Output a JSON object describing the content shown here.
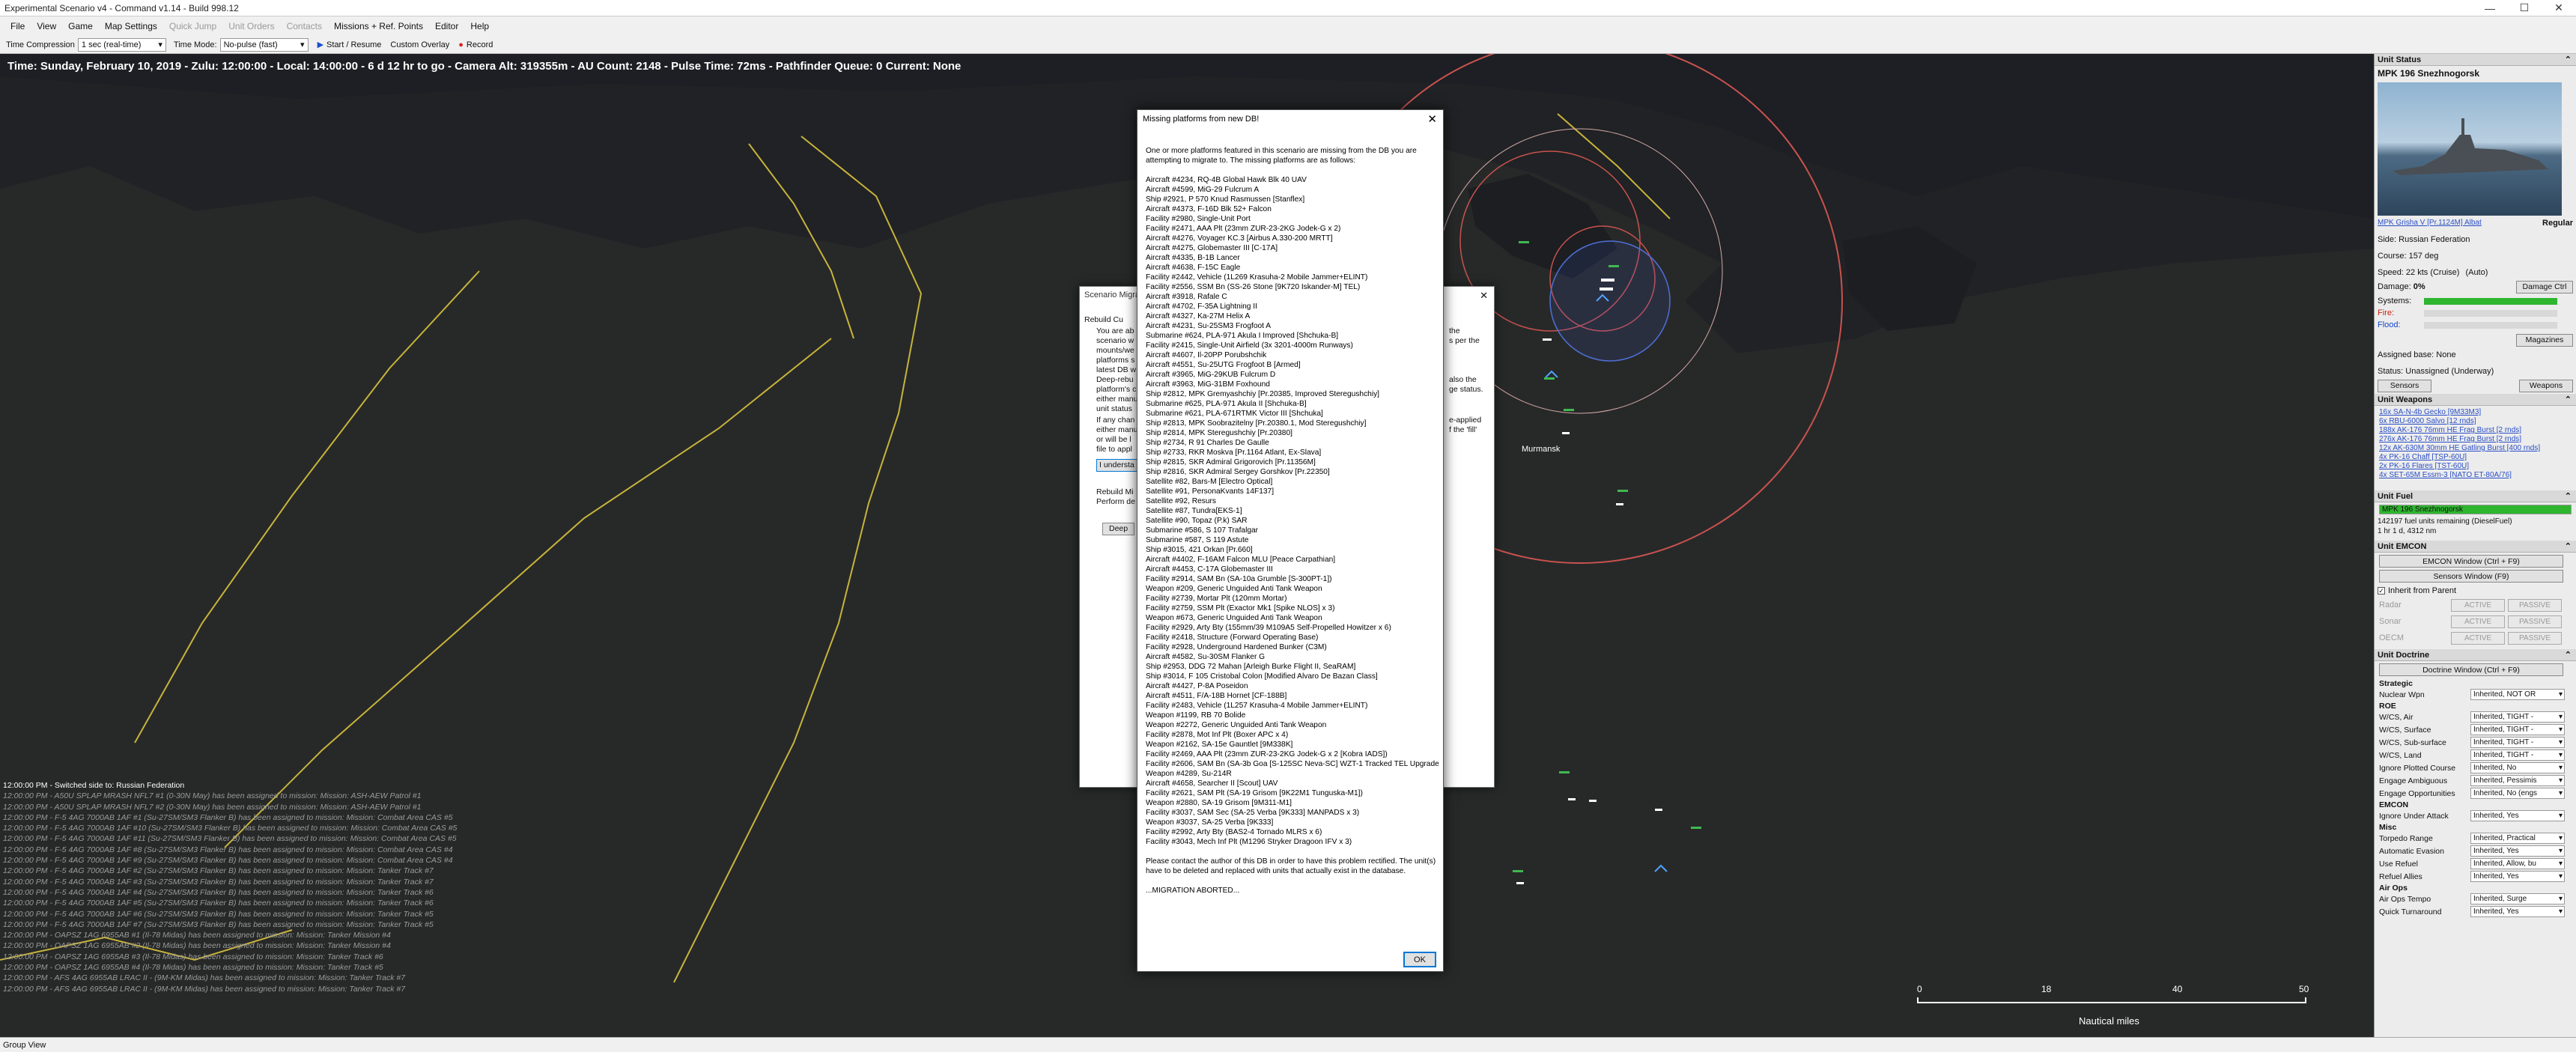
{
  "window": {
    "title": "Experimental Scenario v4 - Command v1.14 - Build 998.12",
    "controls": [
      "—",
      "☐",
      "✕"
    ]
  },
  "menu": [
    {
      "label": "File",
      "enabled": true
    },
    {
      "label": "View",
      "enabled": true
    },
    {
      "label": "Game",
      "enabled": true
    },
    {
      "label": "Map Settings",
      "enabled": true
    },
    {
      "label": "Quick Jump",
      "enabled": false
    },
    {
      "label": "Unit Orders",
      "enabled": false
    },
    {
      "label": "Contacts",
      "enabled": false
    },
    {
      "label": "Missions + Ref. Points",
      "enabled": true
    },
    {
      "label": "Editor",
      "enabled": true
    },
    {
      "label": "Help",
      "enabled": true
    }
  ],
  "toolbar": {
    "time_compression_label": "Time Compression",
    "time_compression_value": "1 sec (real-time)",
    "time_mode_label": "Time Mode:",
    "time_mode_value": "No-pulse (fast)",
    "start_resume": "Start / Resume",
    "custom_overlay": "Custom Overlay",
    "record": "Record"
  },
  "status_line": "Time: Sunday, February 10, 2019 - Zulu: 12:00:00 - Local: 14:00:00 - 6 d 12 hr to go -  Camera Alt: 319355m - AU Count: 2148 - Pulse Time: 72ms - Pathfinder Queue: 0 Current: None",
  "map": {
    "place_label": "Murmansk",
    "scale": {
      "ticks": [
        "0",
        "18",
        "40",
        "50"
      ],
      "unit": "Nautical miles"
    }
  },
  "message_log": [
    "12:00:00 PM - Switched side to: Russian Federation",
    "12:00:00 PM - A50U SPLAP MRASH NFL7 #1 (0-30N May) has been assigned to mission: Mission: ASH-AEW Patrol #1",
    "12:00:00 PM - A50U SPLAP MRASH NFL7 #2 (0-30N May) has been assigned to mission: Mission: ASH-AEW Patrol #1",
    "12:00:00 PM - F-5 4AG 7000AB 1AF #1 (Su-27SM/SM3 Flanker B) has been assigned to mission: Mission: Combat Area CAS #5",
    "12:00:00 PM - F-5 4AG 7000AB 1AF #10 (Su-27SM/SM3 Flanker B) has been assigned to mission: Mission: Combat Area CAS #5",
    "12:00:00 PM - F-5 4AG 7000AB 1AF #11 (Su-27SM/SM3 Flanker B) has been assigned to mission: Mission: Combat Area CAS #5",
    "12:00:00 PM - F-5 4AG 7000AB 1AF #8 (Su-27SM/SM3 Flanker B) has been assigned to mission: Mission: Combat Area CAS #4",
    "12:00:00 PM - F-5 4AG 7000AB 1AF #9 (Su-27SM/SM3 Flanker B) has been assigned to mission: Mission: Combat Area CAS #4",
    "12:00:00 PM - F-5 4AG 7000AB 1AF #2 (Su-27SM/SM3 Flanker B) has been assigned to mission: Mission: Tanker Track #7",
    "12:00:00 PM - F-5 4AG 7000AB 1AF #3 (Su-27SM/SM3 Flanker B) has been assigned to mission: Mission: Tanker Track #7",
    "12:00:00 PM - F-5 4AG 7000AB 1AF #4 (Su-27SM/SM3 Flanker B) has been assigned to mission: Mission: Tanker Track #6",
    "12:00:00 PM - F-5 4AG 7000AB 1AF #5 (Su-27SM/SM3 Flanker B) has been assigned to mission: Mission: Tanker Track #6",
    "12:00:00 PM - F-5 4AG 7000AB 1AF #6 (Su-27SM/SM3 Flanker B) has been assigned to mission: Mission: Tanker Track #5",
    "12:00:00 PM - F-5 4AG 7000AB 1AF #7 (Su-27SM/SM3 Flanker B) has been assigned to mission: Mission: Tanker Track #5",
    "12:00:00 PM - OAPSZ 1AG 6955AB #1 (Il-78 Midas) has been assigned to mission: Mission: Tanker Mission #4",
    "12:00:00 PM - OAPSZ 1AG 6955AB #2 (Il-78 Midas) has been assigned to mission: Mission: Tanker Mission #4",
    "12:00:00 PM - OAPSZ 1AG 6955AB #3 (Il-78 Midas) has been assigned to mission: Mission: Tanker Track #6",
    "12:00:00 PM - OAPSZ 1AG 6955AB #4 (Il-78 Midas) has been assigned to mission: Mission: Tanker Track #5",
    "12:00:00 PM - AFS 4AG 6955AB LRAC II - (9M-KM Midas) has been assigned to mission: Mission: Tanker Track #7",
    "12:00:00 PM - AFS 4AG 6955AB LRAC II - (9M-KM Midas) has been assigned to mission: Mission: Tanker Track #7"
  ],
  "bottom_bar": "Group View",
  "bg_dialog": {
    "title": "Scenario Migration",
    "fragments": [
      "Rebuild Cu",
      "You are ab",
      "scenario w",
      "mounts/we",
      "platforms s",
      "latest DB w",
      "Deep-rebu",
      "platform's c",
      "either manu",
      "unit status",
      "If any chan",
      "either manu",
      "or will be l",
      "file to appl",
      "I understa",
      "Rebuild Mi",
      "Perform de",
      "Deep",
      "the",
      "s per the",
      "also the",
      "ge status.",
      "e-applied",
      "f the 'fill'"
    ]
  },
  "dialog": {
    "title": "Missing platforms from new DB!",
    "intro": "One or more platforms featured in this scenario are missing from the DB you are attempting to migrate to. The missing platforms are as follows:",
    "items": [
      "Aircraft #4234, RQ-4B Global Hawk Blk 40 UAV",
      "Aircraft #4599, MiG-29 Fulcrum A",
      "Ship #2921, P 570 Knud Rasmussen [Stanflex]",
      "Aircraft #4373, F-16D Blk 52+ Falcon",
      "Facility #2980, Single-Unit Port",
      "Facility #2471, AAA Plt (23mm ZUR-23-2KG Jodek-G x 2)",
      "Aircraft #4276, Voyager KC.3 [Airbus A.330-200 MRTT]",
      "Aircraft #4275, Globemaster III [C-17A]",
      "Aircraft #4335, B-1B Lancer",
      "Aircraft #4638, F-15C Eagle",
      "Facility #2442, Vehicle (1L269 Krasuha-2 Mobile Jammer+ELINT)",
      "Facility #2556, SSM Bn (SS-26 Stone [9K720 Iskander-M] TEL)",
      "Aircraft #3918, Rafale C",
      "Aircraft #4702, F-35A Lightning II",
      "Aircraft #4327, Ka-27M Helix A",
      "Aircraft #4231, Su-25SM3 Frogfoot A",
      "Submarine #624, PLA-971 Akula I Improved [Shchuka-B]",
      "Facility #2415, Single-Unit Airfield (3x 3201-4000m Runways)",
      "Aircraft #4607, Il-20PP Porubshchik",
      "Aircraft #4551, Su-25UTG Frogfoot B [Armed]",
      "Aircraft #3965, MiG-29KUB Fulcrum D",
      "Aircraft #3963, MiG-31BM Foxhound",
      "Ship #2812, MPK Gremyashchiy [Pr.20385, Improved Steregushchiy]",
      "Submarine #625, PLA-971 Akula II [Shchuka-B]",
      "Submarine #621, PLA-671RTMK Victor III [Shchuka]",
      "Ship #2813, MPK Soobrazitelny [Pr.20380.1, Mod Steregushchiy]",
      "Ship #2814, MPK Steregushchiy [Pr.20380]",
      "Ship #2734, R 91 Charles De Gaulle",
      "Ship #2733, RKR Moskva [Pr.1164 Atlant, Ex-Slava]",
      "Ship #2815, SKR Admiral Grigorovich [Pr.11356M]",
      "Ship #2816, SKR Admiral Sergey Gorshkov [Pr.22350]",
      "Satellite #82, Bars-M [Electro Optical]",
      "Satellite #91, PersonaKvants 14F137]",
      "Satellite #92, Resurs",
      "Satellite #87, Tundra[EKS-1]",
      "Satellite #90, Topaz (P.k) SAR",
      "Submarine #586, S 107 Trafalgar",
      "Submarine #587, S 119 Astute",
      "Ship #3015, 421 Orkan [Pr.660]",
      "Aircraft #4402, F-16AM Falcon MLU [Peace Carpathian]",
      "Aircraft #4453, C-17A Globemaster III",
      "Facility #2914, SAM Bn (SA-10a Grumble [S-300PT-1])",
      "Weapon #209, Generic Unguided Anti Tank Weapon",
      "Facility #2739, Mortar Plt (120mm Mortar)",
      "Facility #2759, SSM Plt (Exactor Mk1 [Spike NLOS] x 3)",
      "Weapon #673, Generic Unguided Anti Tank Weapon",
      "Facility #2929, Arty Bty (155mm/39 M109A5 Self-Propelled Howitzer x 6)",
      "Facility #2418, Structure (Forward Operating Base)",
      "Facility #2928, Underground Hardened Bunker (C3M)",
      "Aircraft #4582, Su-30SM Flanker G",
      "Ship #2953, DDG 72 Mahan [Arleigh Burke Flight II, SeaRAM]",
      "Ship #3014, F 105 Cristobal Colon [Modified Alvaro De Bazan Class]",
      "Aircraft #4427, P-8A Poseidon",
      "Aircraft #4511, F/A-18B Hornet [CF-188B]",
      "Facility #2483, Vehicle (1L257 Krasuha-4 Mobile Jammer+ELINT)",
      "Weapon #1199, RB 70 Bolide",
      "Weapon #2272, Generic Unguided Anti Tank Weapon",
      "Facility #2878, Mot Inf Plt (Boxer APC x 4)",
      "Weapon #2162, SA-15e Gauntlet [9M338K]",
      "Facility #2469, AAA Plt (23mm ZUR-23-2KG Jodek-G x 2 [Kobra IADS])",
      "Facility #2606, SAM Bn (SA-3b Goa [S-125SC Neva-SC] WZT-1 Tracked TEL Upgrade])",
      "Weapon #4289, Su-214R",
      "Aircraft #4658, Searcher II [Scout] UAV",
      "Facility #2621, SAM Plt (SA-19 Grisom [9K22M1 Tunguska-M1])",
      "Weapon #2880, SA-19 Grisom [9M311-M1]",
      "Facility #3037, SAM Sec (SA-25 Verba [9K333] MANPADS x 3)",
      "Weapon #3037, SA-25 Verba [9K333]",
      "Facility #2992, Arty Bty (BAS2-4 Tornado MLRS x 6)",
      "Facility #3043, Mech Inf Plt (M1296 Stryker Dragoon IFV x 3)"
    ],
    "outro": "Please contact the author of this DB in order to have this problem rectified. The unit(s) have to be deleted and replaced with units that actually exist in the database.",
    "aborted": "...MIGRATION ABORTED...",
    "ok": "OK"
  },
  "panel": {
    "unit_status": {
      "header": "Unit Status",
      "unit_name": "MPK 196 Snezhnogorsk",
      "class_link": "MPK Grisha V [Pr.1124M] Albat",
      "proficiency": "Regular",
      "side": "Side: Russian Federation",
      "course": "Course: 157 deg",
      "speed": "Speed: 22 kts (Cruise)",
      "speed_auto": "(Auto)",
      "damage": "Damage:",
      "damage_value": "0%",
      "damage_ctrl": "Damage Ctrl",
      "systems": "Systems:",
      "fire": "Fire:",
      "flood": "Flood:",
      "magazines": "Magazines",
      "assigned_base": "Assigned base: None",
      "status": "Status: Unassigned (Underway)",
      "sensors": "Sensors",
      "weapons": "Weapons"
    },
    "unit_weapons": {
      "header": "Unit Weapons",
      "items": [
        "16x SA-N-4b Gecko [9M33M3]",
        "6x RBU-6000 Salvo [12 rnds]",
        "188x AK-176 76mm HE Frag Burst [2 rnds]",
        "276x AK-176 76mm HE Frag Burst [2 rnds]",
        "12x AK-630M 30mm HE Gatling Burst [400 rnds]",
        "4x PK-16 Chaff [TSP-60U]",
        "2x PK-16 Flares [TST-60U]",
        "4x SET-65M Essm-3 [NATO ET-80A/76]"
      ]
    },
    "unit_fuel": {
      "header": "Unit Fuel",
      "bar_label": "MPK 196 Snezhnogorsk",
      "fuel_level": 1.0,
      "remaining": "142197 fuel units remaining (DieselFuel)",
      "time": "1 hr 1 d, 4312 nm"
    },
    "emcon": {
      "header": "Unit EMCON",
      "window_btn": "EMCON Window (Ctrl + F9)",
      "sensors_btn": "Sensors Window (F9)",
      "inherit": "Inherit from Parent",
      "rows": [
        {
          "label": "Radar"
        },
        {
          "label": "Sonar"
        },
        {
          "label": "OECM"
        }
      ],
      "active": "ACTIVE",
      "passive": "PASSIVE"
    },
    "doctrine": {
      "header": "Unit Doctrine",
      "window_btn": "Doctrine Window (Ctrl + F9)",
      "rows": [
        {
          "label": "Strategic",
          "value": ""
        },
        {
          "label": "Nuclear Wpn",
          "value": "Inherited, NOT OR"
        },
        {
          "label": "ROE",
          "value": ""
        },
        {
          "label": "W/CS, Air",
          "value": "Inherited, TIGHT -"
        },
        {
          "label": "W/CS, Surface",
          "value": "Inherited, TIGHT -"
        },
        {
          "label": "W/CS, Sub-surface",
          "value": "Inherited, TIGHT -"
        },
        {
          "label": "W/CS, Land",
          "value": "Inherited, TIGHT -"
        },
        {
          "label": "Ignore Plotted Course",
          "value": "Inherited, No"
        },
        {
          "label": "Engage Ambiguous",
          "value": "Inherited, Pessimis"
        },
        {
          "label": "Engage Opportunities",
          "value": "Inherited, No (engs"
        },
        {
          "label": "EMCON",
          "value": ""
        },
        {
          "label": "Ignore Under Attack",
          "value": "Inherited, Yes"
        },
        {
          "label": "Misc",
          "value": ""
        },
        {
          "label": "Torpedo Range",
          "value": "Inherited, Practical"
        },
        {
          "label": "Automatic Evasion",
          "value": "Inherited, Yes"
        },
        {
          "label": "Use Refuel",
          "value": "Inherited, Allow, bu"
        },
        {
          "label": "Refuel Allies",
          "value": "Inherited, Yes"
        },
        {
          "label": "Air Ops",
          "value": ""
        },
        {
          "label": "Air Ops Tempo",
          "value": "Inherited, Surge"
        },
        {
          "label": "Quick Turnaround",
          "value": "Inherited, Yes"
        }
      ]
    }
  },
  "colors": {
    "land": "#282a2a",
    "sea": "#1d1f24",
    "range_rings": "#c9524e",
    "zone_lines": "#c8b43a",
    "friendly_units": "#3fb950",
    "accent": "#0078d7"
  }
}
